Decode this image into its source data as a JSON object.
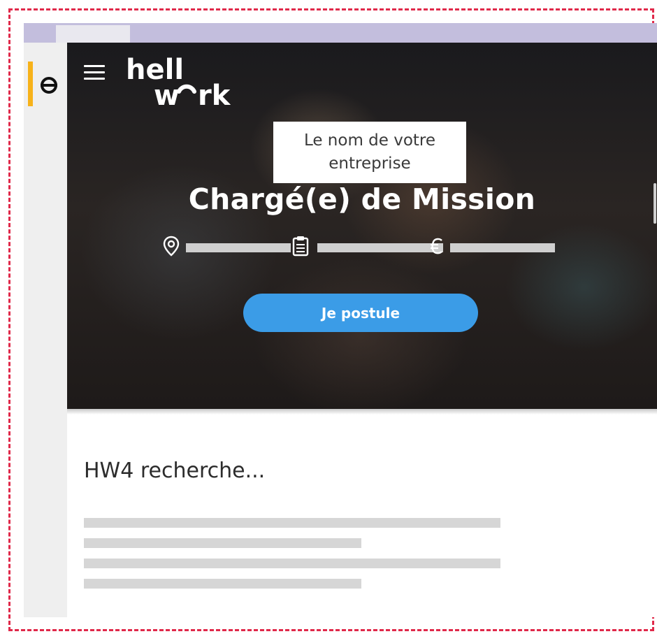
{
  "brand": {
    "logo_text": "hellowork",
    "logo_line1": "hell",
    "logo_line2": "w",
    "logo_line2_end": "rk"
  },
  "hero": {
    "company_name": "Le nom de votre entreprise",
    "job_title": "Chargé(e) de Mission",
    "meta_icons": [
      "location-pin-icon",
      "clipboard-icon",
      "euro-icon"
    ],
    "apply_button": "Je postule"
  },
  "content": {
    "section_title": "HW4 recherche..."
  },
  "colors": {
    "frame_border": "#e0294a",
    "browser_bar": "#c3bedd",
    "rail_accent": "#f7b21a",
    "apply_button": "#3b9ce7",
    "placeholder": "#d6d6d6"
  }
}
